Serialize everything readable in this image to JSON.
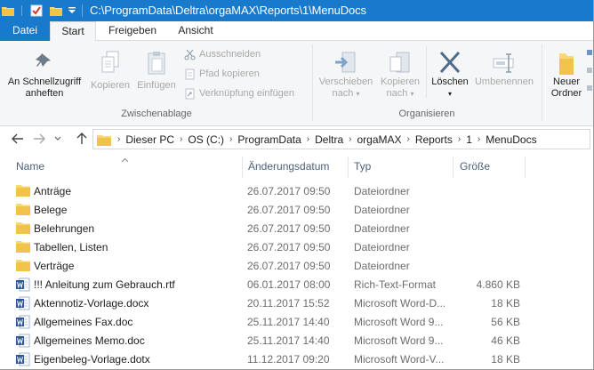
{
  "window": {
    "title": "C:\\ProgramData\\Deltra\\orgaMAX\\Reports\\1\\MenuDocs"
  },
  "tabs": {
    "file": "Datei",
    "start": "Start",
    "share": "Freigeben",
    "view": "Ansicht"
  },
  "ribbon": {
    "pin_line1": "An Schnellzugriff",
    "pin_line2": "anheften",
    "copy": "Kopieren",
    "paste": "Einfügen",
    "cut": "Ausschneiden",
    "copy_path": "Pfad kopieren",
    "paste_shortcut": "Verknüpfung einfügen",
    "clipboard_group": "Zwischenablage",
    "move_line1": "Verschieben",
    "move_line2": "nach",
    "copyto_line1": "Kopieren",
    "copyto_line2": "nach",
    "delete": "Löschen",
    "rename": "Umbenennen",
    "organize_group": "Organisieren",
    "new_line1": "Neuer",
    "new_line2": "Ordner"
  },
  "address": {
    "crumbs": [
      "Dieser PC",
      "OS (C:)",
      "ProgramData",
      "Deltra",
      "orgaMAX",
      "Reports",
      "1",
      "MenuDocs"
    ]
  },
  "columns": {
    "name": "Name",
    "date": "Änderungsdatum",
    "type": "Typ",
    "size": "Größe"
  },
  "files": [
    {
      "icon": "folder-icon",
      "name": "Anträge",
      "date": "26.07.2017 09:50",
      "type": "Dateiordner",
      "size": ""
    },
    {
      "icon": "folder-icon",
      "name": "Belege",
      "date": "26.07.2017 09:50",
      "type": "Dateiordner",
      "size": ""
    },
    {
      "icon": "folder-icon",
      "name": "Belehrungen",
      "date": "26.07.2017 09:50",
      "type": "Dateiordner",
      "size": ""
    },
    {
      "icon": "folder-icon",
      "name": "Tabellen, Listen",
      "date": "26.07.2017 09:50",
      "type": "Dateiordner",
      "size": ""
    },
    {
      "icon": "folder-icon",
      "name": "Verträge",
      "date": "26.07.2017 09:50",
      "type": "Dateiordner",
      "size": ""
    },
    {
      "icon": "word-icon",
      "name": "!!! Anleitung zum Gebrauch.rtf",
      "date": "06.01.2017 08:00",
      "type": "Rich-Text-Format",
      "size": "4.860 KB"
    },
    {
      "icon": "word-icon",
      "name": "Aktennotiz-Vorlage.docx",
      "date": "20.11.2017 15:52",
      "type": "Microsoft Word-D...",
      "size": "18 KB"
    },
    {
      "icon": "word-icon",
      "name": "Allgemeines Fax.doc",
      "date": "25.11.2017 14:40",
      "type": "Microsoft Word 9...",
      "size": "56 KB"
    },
    {
      "icon": "word-icon",
      "name": "Allgemeines Memo.doc",
      "date": "25.11.2017 14:40",
      "type": "Microsoft Word 9...",
      "size": "46 KB"
    },
    {
      "icon": "word-icon",
      "name": "Eigenbeleg-Vorlage.dotx",
      "date": "11.12.2017 09:20",
      "type": "Microsoft Word-V...",
      "size": "18 KB"
    }
  ]
}
